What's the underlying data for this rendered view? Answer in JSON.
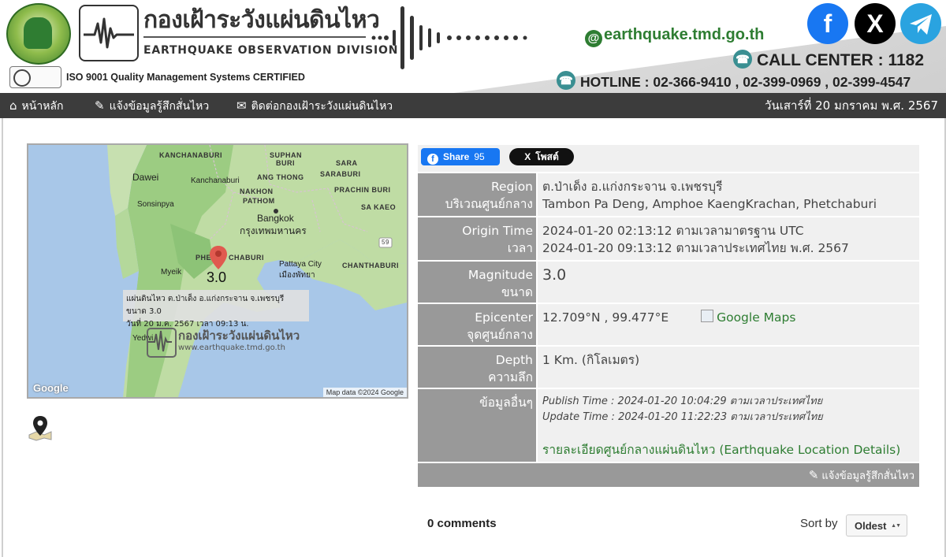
{
  "header": {
    "title_th": "กองเฝ้าระวังแผ่นดินไหว",
    "title_en": "EARTHQUAKE  OBSERVATION  DIVISION",
    "iso": "ISO 9001 Quality Management Systems CERTIFIED",
    "site_url": "earthquake.tmd.go.th",
    "call_center": "CALL CENTER : 1182",
    "hotline": "HOTLINE : 02-366-9410 , 02-399-0969 , 02-399-4547",
    "social": {
      "facebook_icon": "facebook-icon",
      "x_icon": "x-icon",
      "telegram_icon": "telegram-icon"
    }
  },
  "nav": {
    "home": "หน้าหลัก",
    "report": "แจ้งข้อมูลรู้สึกสั่นไหว",
    "contact": "ติดต่อกองเฝ้าระวังแผ่นดินไหว",
    "date": "วันเสาร์ที่ 20 มกราคม พ.ศ. 2567"
  },
  "map": {
    "labels": {
      "kanchanaburi_prov": "KANCHANABURI",
      "suphan": "SUPHAN",
      "buri": "BURI",
      "sara": "SARA",
      "ang_thong": "ANG THONG",
      "dawei": "Dawei",
      "kanchanaburi_city": "Kanchanaburi",
      "nakhon": "NAKHON",
      "pathom": "PATHOM",
      "prachin_buri": "PRACHIN BURI",
      "sonsinpya": "Sonsinpya",
      "bangkok": "Bangkok",
      "bangkok_th": "กรุงเทพมหานคร",
      "sa_kaeo": "SA KAEO",
      "saraburi": "SARABURI",
      "phetchaburi_pre": "PHE",
      "phetchaburi_post": "CHABURI",
      "pattaya": "Pattaya City",
      "pattaya_th": "เมืองพัทยา",
      "chanthaburi": "CHANTHABURI",
      "myeik": "Myeik",
      "road_59": "59",
      "yedwi": "Yedwi"
    },
    "magnitude": "3.0",
    "popup_line1": "แผ่นดินไหว ต.ป่าเด็ง อ.แก่งกระจาน จ.เพชรบุรี ขนาด 3.0",
    "popup_line2": "วันที่ 20 ม.ค. 2567 เวลา 09:13 น.",
    "watermark_title": "กองเฝ้าระวังแผ่นดินไหว",
    "watermark_url": "www.earthquake.tmd.go.th",
    "google": "Google",
    "attribution": "Map data ©2024 Google"
  },
  "share": {
    "fb_label": "Share",
    "fb_count": "95",
    "x_label": "โพสต์"
  },
  "info": {
    "region_label_en": "Region",
    "region_label_th": "บริเวณศูนย์กลาง",
    "region_th": "ต.ป่าเด็ง อ.แก่งกระจาน จ.เพชรบุรี",
    "region_en": "Tambon Pa Deng, Amphoe KaengKrachan, Phetchaburi",
    "origin_label_en": "Origin Time",
    "origin_label_th": "เวลา",
    "origin_utc": "2024-01-20 02:13:12 ตามเวลามาตรฐาน UTC",
    "origin_local": "2024-01-20 09:13:12 ตามเวลาประเทศไทย พ.ศ. 2567",
    "mag_label_en": "Magnitude",
    "mag_label_th": "ขนาด",
    "magnitude": "3.0",
    "epi_label_en": "Epicenter",
    "epi_label_th": "จุดศูนย์กลาง",
    "epicenter": "12.709°N , 99.477°E",
    "google_maps": "Google Maps",
    "depth_label_en": "Depth",
    "depth_label_th": "ความลึก",
    "depth": "1 Km. (กิโลเมตร)",
    "other_label": "ข้อมูลอื่นๆ",
    "publish": "Publish Time : 2024-01-20 10:04:29 ตามเวลาประเทศไทย",
    "update": "Update Time : 2024-01-20 11:22:23 ตามเวลาประเทศไทย",
    "details_link": "รายละเอียดศูนย์กลางแผ่นดินไหว (Earthquake Location Details)",
    "report_btn": "แจ้งข้อมูลรู้สึกสั่นไหว"
  },
  "comments": {
    "count": "0 comments",
    "sort_label": "Sort by",
    "sort_value": "Oldest"
  }
}
